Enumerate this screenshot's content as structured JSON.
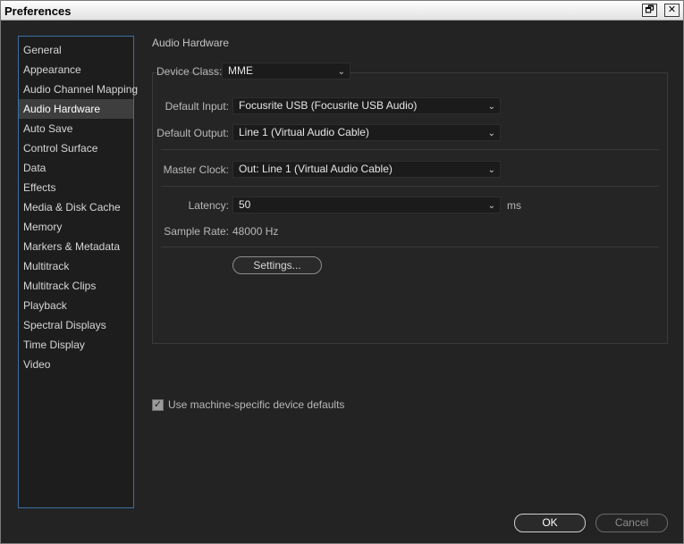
{
  "window": {
    "title": "Preferences",
    "restore_glyph": "🗗",
    "close_glyph": "✕"
  },
  "sidebar": {
    "items": [
      {
        "label": "General"
      },
      {
        "label": "Appearance"
      },
      {
        "label": "Audio Channel Mapping"
      },
      {
        "label": "Audio Hardware",
        "active": true
      },
      {
        "label": "Auto Save"
      },
      {
        "label": "Control Surface"
      },
      {
        "label": "Data"
      },
      {
        "label": "Effects"
      },
      {
        "label": "Media & Disk Cache"
      },
      {
        "label": "Memory"
      },
      {
        "label": "Markers & Metadata"
      },
      {
        "label": "Multitrack"
      },
      {
        "label": "Multitrack Clips"
      },
      {
        "label": "Playback"
      },
      {
        "label": "Spectral Displays"
      },
      {
        "label": "Time Display"
      },
      {
        "label": "Video"
      }
    ]
  },
  "main": {
    "section_title": "Audio Hardware",
    "device_class": {
      "label": "Device Class:",
      "value": "MME"
    },
    "default_input": {
      "label": "Default Input:",
      "value": "Focusrite USB (Focusrite USB Audio)"
    },
    "default_output": {
      "label": "Default Output:",
      "value": "Line 1 (Virtual Audio Cable)"
    },
    "master_clock": {
      "label": "Master Clock:",
      "value": "Out: Line 1 (Virtual Audio Cable)"
    },
    "latency": {
      "label": "Latency:",
      "value": "50",
      "unit": "ms"
    },
    "sample_rate": {
      "label": "Sample Rate:",
      "value": "48000 Hz"
    },
    "settings_button": "Settings...",
    "machine_defaults": {
      "label": "Use machine-specific device defaults",
      "checked": true
    }
  },
  "footer": {
    "ok": "OK",
    "cancel": "Cancel"
  },
  "colors": {
    "background": "#232323",
    "sidebar_border": "#3d6fa6",
    "active_item": "#3e3e3e"
  },
  "icons": {
    "dropdown": "chevron-down-icon",
    "checkbox": "checkmark-icon"
  }
}
